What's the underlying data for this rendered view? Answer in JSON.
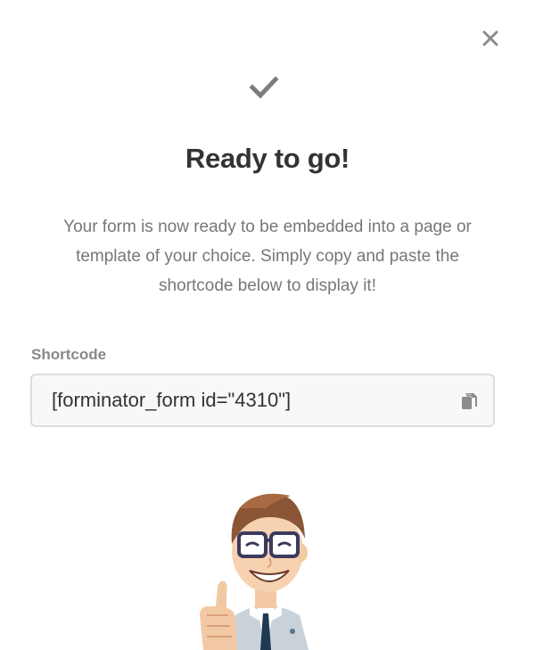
{
  "modal": {
    "title": "Ready to go!",
    "description": "Your form is now ready to be embedded into a page or template of your choice. Simply copy and paste the shortcode below to display it!",
    "shortcode": {
      "label": "Shortcode",
      "value": "[forminator_form id=\"4310\"]"
    }
  },
  "icons": {
    "close": "close-icon",
    "check": "checkmark-icon",
    "copy": "copy-icon"
  },
  "colors": {
    "title": "#333333",
    "text": "#777777",
    "icon": "#888888"
  }
}
